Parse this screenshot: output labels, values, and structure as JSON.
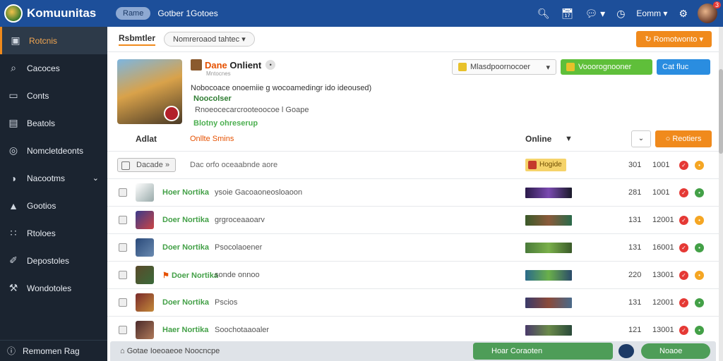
{
  "header": {
    "app_title": "Komuunitas",
    "nav_pill": "Rame",
    "nav_link": "Gotber 1Gotoes",
    "user_name": "Eomm",
    "avatar_badge": "3"
  },
  "sidebar": {
    "items": [
      {
        "label": "Rotcnis",
        "icon": "gamepad-icon"
      },
      {
        "label": "Cacoces",
        "icon": "search-icon"
      },
      {
        "label": "Conts",
        "icon": "monitor-icon"
      },
      {
        "label": "Beatols",
        "icon": "folder-icon"
      },
      {
        "label": "Nomcletdeonts",
        "icon": "target-icon"
      },
      {
        "label": "Nacootms",
        "icon": "globe-icon"
      },
      {
        "label": "Gootios",
        "icon": "user-icon"
      },
      {
        "label": "Rtoloes",
        "icon": "share-icon"
      },
      {
        "label": "Depostoles",
        "icon": "document-icon"
      },
      {
        "label": "Wondotoles",
        "icon": "tools-icon"
      }
    ],
    "bottom_label": "Remomen Rag"
  },
  "toolbar": {
    "title": "Rsbmtler",
    "select_value": "Nomreroaod tahtec",
    "action_button": "Romotwonto"
  },
  "game": {
    "title_part1": "Dane",
    "title_part2": "Onlient",
    "subtitle": "Mntocnes",
    "line1": "Nobocoace onoemiie g wocoamedingr ido ideoused)",
    "line2": "Noocolser",
    "line3": "Rnoeocecarcrooteoocoe l Goape",
    "line4": "Blotny ohreserup",
    "tag_dropdown": "Mlasdpoornocoer",
    "tag_green": "Vooorognooner",
    "tag_blue": "Cat fluc"
  },
  "table": {
    "col_name": "Adlat",
    "col_online": "Onllte Smins",
    "col_right": "Online",
    "col_button": "Reotiers",
    "first_row": {
      "chip": "Dacade",
      "desc": "Dac orfo oceaabnde aore",
      "tag": "Hogide",
      "num": "301",
      "time": "1001"
    },
    "rows": [
      {
        "name": "Hoer Nortika",
        "desc": "ysoie Gacoaoneosloaoon",
        "num": "281",
        "time": "1001",
        "dot2": "#43a047"
      },
      {
        "name": "Doer Nortika",
        "desc": "grgroceaaoarv",
        "num": "131",
        "time": "12001",
        "dot2": "#f5a623"
      },
      {
        "name": "Doer Nortika",
        "desc": "Psocolaoener",
        "num": "131",
        "time": "16001",
        "dot2": "#43a047"
      },
      {
        "name": "Doer Nortika",
        "desc": "sonde onnoo",
        "num": "220",
        "time": "13001",
        "dot2": "#f5a623"
      },
      {
        "name": "Doer Nortika",
        "desc": "Pscios",
        "num": "131",
        "time": "12001",
        "dot2": "#43a047"
      },
      {
        "name": "Haer Nortika",
        "desc": "Soochotaaoaler",
        "num": "121",
        "time": "13001",
        "dot2": "#43a047"
      }
    ]
  },
  "footer": {
    "text": "Gotae  Ioeoaeoe  Noocncpe",
    "green_label": "Hoar Coraoten",
    "pill_label": "Noaoe"
  },
  "colors": {
    "topbar": "#1d4f9a",
    "sidebar": "#1b2430",
    "accent_orange": "#f08a1c",
    "accent_green": "#5fbf3a",
    "accent_blue": "#2a8de0"
  }
}
